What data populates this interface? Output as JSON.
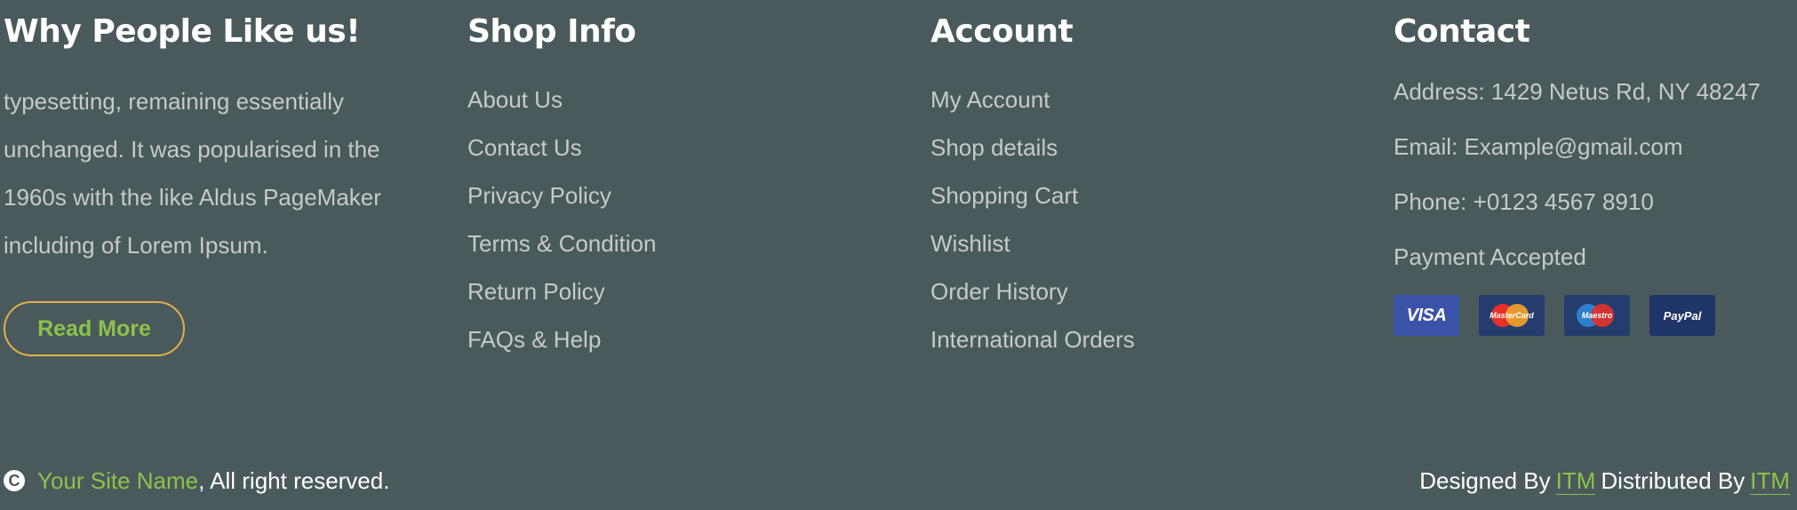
{
  "about": {
    "title": "Why People Like us!",
    "text": "typesetting, remaining essentially unchanged. It was popularised in the 1960s with the like Aldus PageMaker including of Lorem Ipsum.",
    "button": "Read More"
  },
  "shop_info": {
    "title": "Shop Info",
    "links": [
      "About Us",
      "Contact Us",
      "Privacy Policy",
      "Terms & Condition",
      "Return Policy",
      "FAQs & Help"
    ]
  },
  "account": {
    "title": "Account",
    "links": [
      "My Account",
      "Shop details",
      "Shopping Cart",
      "Wishlist",
      "Order History",
      "International Orders"
    ]
  },
  "contact": {
    "title": "Contact",
    "address": "Address: 1429 Netus Rd, NY 48247",
    "email": "Email: Example@gmail.com",
    "phone": "Phone: +0123 4567 8910",
    "payment_label": "Payment Accepted",
    "cards": [
      "VISA",
      "MasterCard",
      "Maestro",
      "PayPal"
    ]
  },
  "bottom": {
    "copyright_symbol": "C",
    "site_name": "Your Site Name",
    "rights": ", All right reserved.",
    "designed_by": "Designed By",
    "designer": "ITM",
    "distributed_by": "Distributed By",
    "distributor": "ITM"
  },
  "colors": {
    "background": "#4a595c",
    "accent_green": "#8bc34a",
    "button_border": "#e2b04a"
  }
}
